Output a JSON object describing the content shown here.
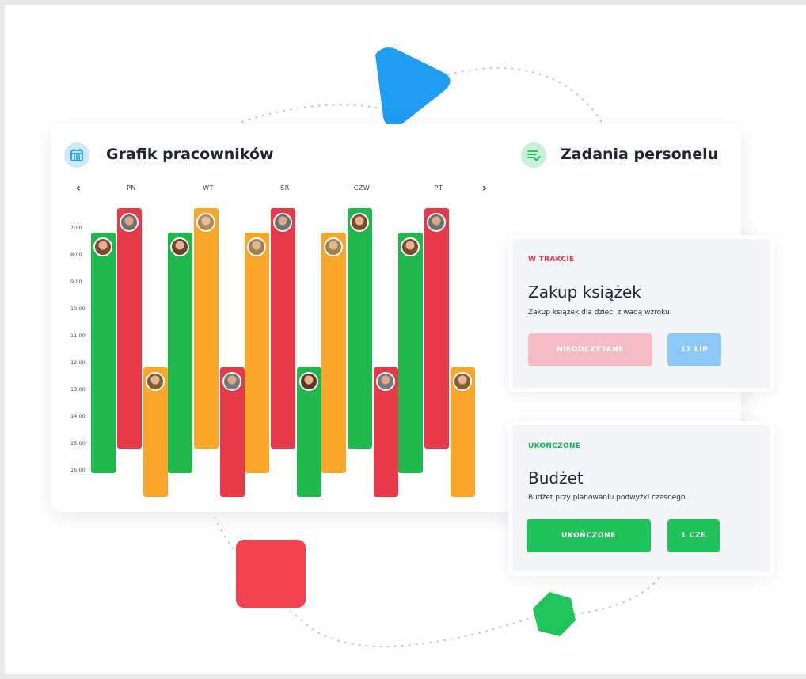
{
  "schedule": {
    "title": "Grafik pracowników",
    "icon": "calendar-icon",
    "nav_prev": "‹",
    "nav_next": "›",
    "days": [
      "PN",
      "WT",
      "ŚR",
      "CZW",
      "PT"
    ],
    "times": [
      "7:00",
      "8:00",
      "9:00",
      "10:00",
      "11:00",
      "12:00",
      "13:00",
      "14:00",
      "15:00",
      "16:00"
    ],
    "colors": {
      "green": "#1fb84c",
      "red": "#e63a4b",
      "orange": "#f9a72a"
    }
  },
  "tasks": {
    "title": "Zadania personelu",
    "icon": "task-list-icon",
    "items": [
      {
        "status": "W TRAKCIE",
        "status_color": "#e0324a",
        "title": "Zakup książek",
        "description": "Zakup książek dla dzieci z wadą wzroku.",
        "primary_button": "NIEODCZYTANE",
        "secondary_button": "17 LIP"
      },
      {
        "status": "UKOŃCZONE",
        "status_color": "#18b955",
        "title": "Budżet",
        "description": "Budżet przy planowaniu podwyżki czesnego.",
        "primary_button": "UKOŃCZONE",
        "secondary_button": "1 CZE"
      }
    ]
  }
}
